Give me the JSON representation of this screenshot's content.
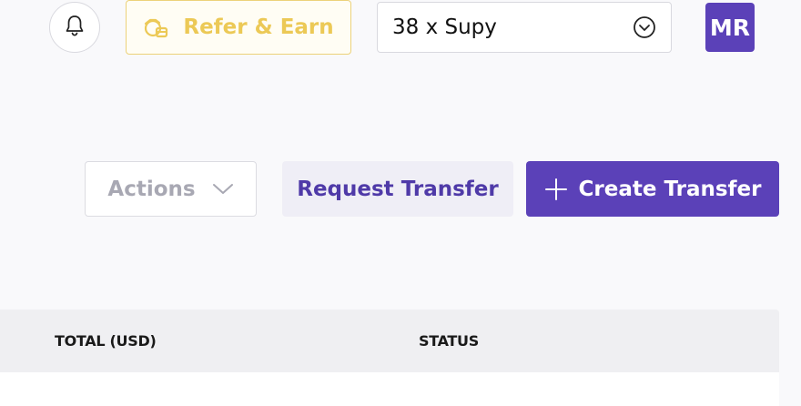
{
  "header": {
    "notifications_icon": "bell-icon",
    "refer_label": "Refer & Earn",
    "refer_icon": "gift-coins-icon",
    "outlet_value": "38 x Supy",
    "outlet_icon": "chevron-down-circle-icon",
    "avatar_initials": "MR"
  },
  "toolbar": {
    "actions_label": "Actions",
    "actions_icon": "chevron-down-icon",
    "request_transfer_label": "Request Transfer",
    "create_transfer_label": "Create Transfer",
    "create_transfer_icon": "plus-icon"
  },
  "table": {
    "columns": [
      "TOTAL (USD)",
      "STATUS"
    ]
  },
  "colors": {
    "primary": "#5b41b8",
    "refer_accent": "#ecc956",
    "background": "#f9f9fb"
  }
}
